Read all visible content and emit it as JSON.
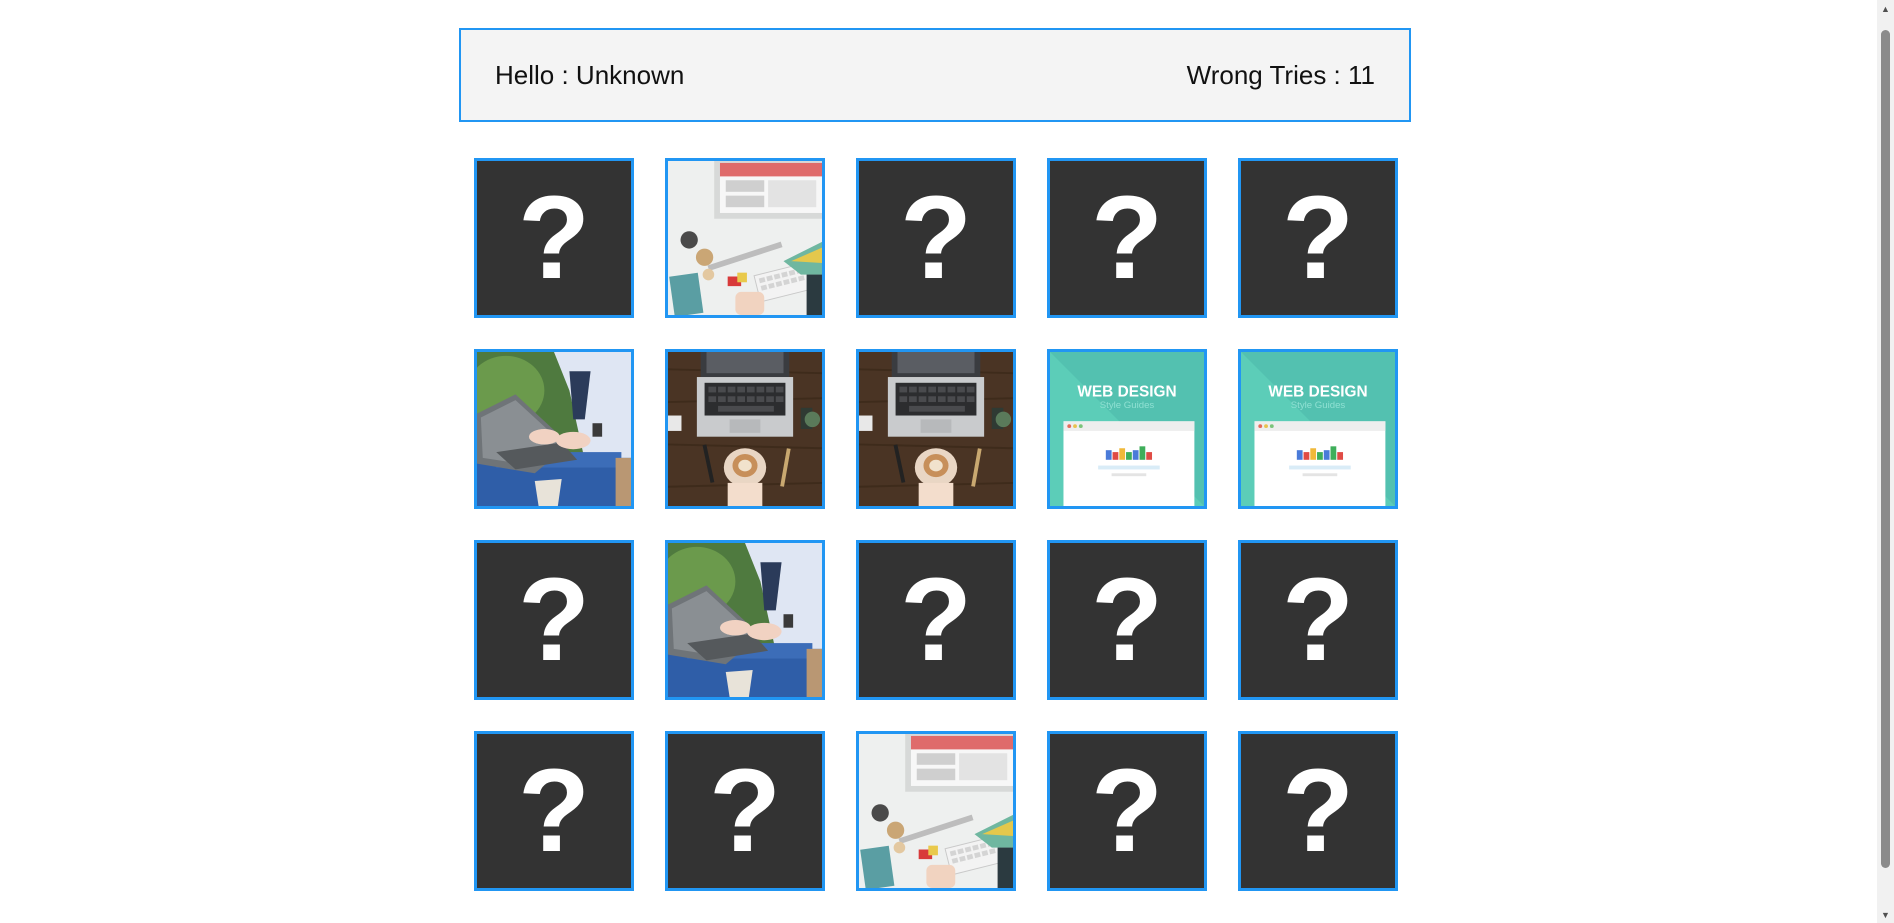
{
  "header": {
    "greeting": "Hello : Unknown",
    "wrong_tries": "Wrong Tries : 11"
  },
  "card_back_symbol": "?",
  "colors": {
    "accent": "#2196f3",
    "card_back": "#333333",
    "header_bg": "#f4f4f4"
  },
  "cards": [
    {
      "state": "hidden",
      "image": "question-mark"
    },
    {
      "state": "revealed",
      "image": "desk-monitor-keyboard"
    },
    {
      "state": "hidden",
      "image": "question-mark"
    },
    {
      "state": "hidden",
      "image": "question-mark"
    },
    {
      "state": "hidden",
      "image": "question-mark"
    },
    {
      "state": "revealed",
      "image": "woman-typing-laptop"
    },
    {
      "state": "revealed",
      "image": "laptop-wood-desk-coffee"
    },
    {
      "state": "revealed",
      "image": "laptop-wood-desk-coffee"
    },
    {
      "state": "revealed",
      "image": "web-design-style-guides",
      "text": "WEB DESIGN",
      "subtext": "Style Guides"
    },
    {
      "state": "revealed",
      "image": "web-design-style-guides",
      "text": "WEB DESIGN",
      "subtext": "Style Guides"
    },
    {
      "state": "hidden",
      "image": "question-mark"
    },
    {
      "state": "revealed",
      "image": "woman-typing-laptop"
    },
    {
      "state": "hidden",
      "image": "question-mark"
    },
    {
      "state": "hidden",
      "image": "question-mark"
    },
    {
      "state": "hidden",
      "image": "question-mark"
    },
    {
      "state": "hidden",
      "image": "question-mark"
    },
    {
      "state": "hidden",
      "image": "question-mark"
    },
    {
      "state": "revealed",
      "image": "desk-monitor-keyboard"
    },
    {
      "state": "hidden",
      "image": "question-mark"
    },
    {
      "state": "hidden",
      "image": "question-mark"
    }
  ]
}
